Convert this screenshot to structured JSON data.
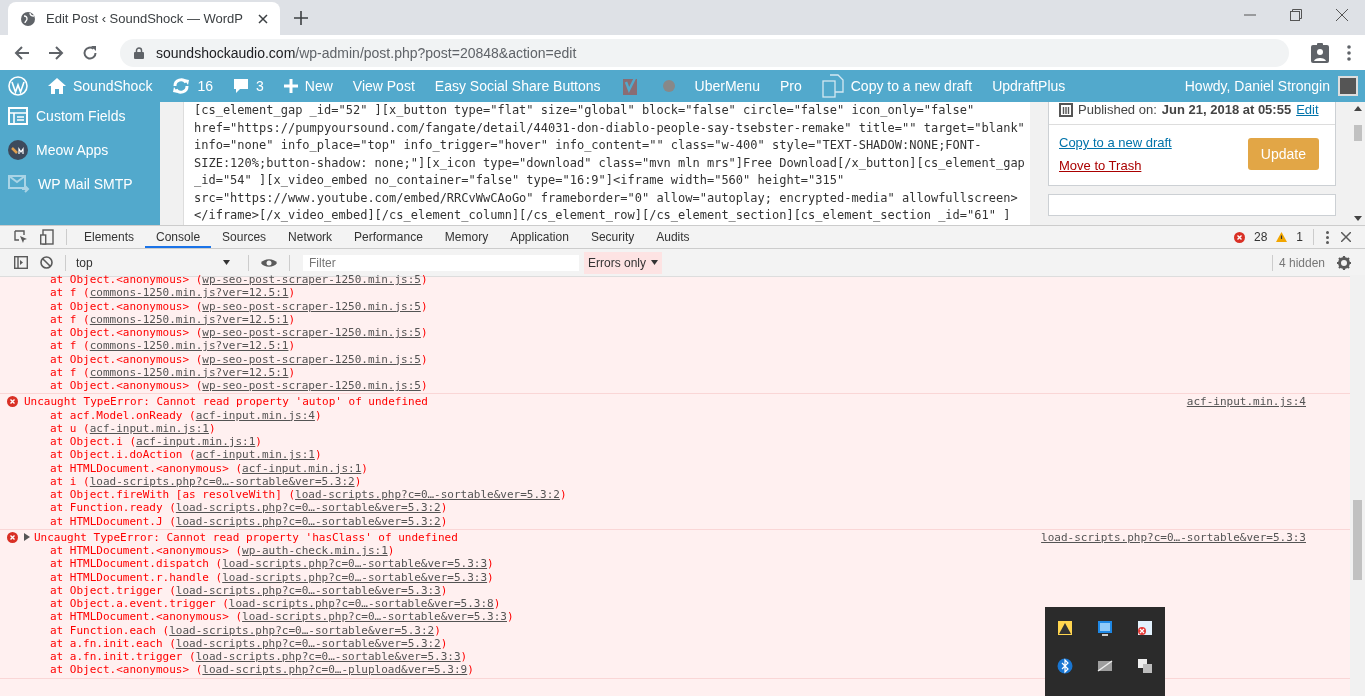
{
  "browser": {
    "tab_title": "Edit Post ‹ SoundShock — WordP",
    "url_host": "soundshockaudio.com",
    "url_path": "/wp-admin/post.php?post=20848&action=edit"
  },
  "admin_bar": {
    "items": [
      {
        "kind": "logo"
      },
      {
        "kind": "site",
        "label": "SoundShock"
      },
      {
        "kind": "updates",
        "label": "16"
      },
      {
        "kind": "comments",
        "label": "3"
      },
      {
        "kind": "new",
        "label": "New"
      },
      {
        "kind": "link",
        "label": "View Post"
      },
      {
        "kind": "link",
        "label": "Easy Social Share Buttons"
      },
      {
        "kind": "yoast"
      },
      {
        "kind": "dot"
      },
      {
        "kind": "link",
        "label": "UberMenu"
      },
      {
        "kind": "link",
        "label": "Pro"
      },
      {
        "kind": "copy",
        "label": "Copy to a new draft"
      },
      {
        "kind": "link",
        "label": "UpdraftPlus"
      }
    ],
    "account": "Howdy, Daniel Strongin"
  },
  "sidebar": {
    "items": [
      {
        "kind": "fields",
        "label": "Custom Fields"
      },
      {
        "kind": "meow",
        "label": "Meow Apps"
      },
      {
        "kind": "mail",
        "label": "WP Mail SMTP"
      }
    ]
  },
  "editor_lines": [
    "[cs_element_gap _id=\"52\" ][x_button type=\"flat\" size=\"global\" block=\"false\" circle=\"false\" icon_only=\"false\"",
    "href=\"https://pumpyoursound.com/fangate/detail/44031-don-diablo-people-say-tsebster-remake\" title=\"\" target=\"blank\"",
    "info=\"none\" info_place=\"top\" info_trigger=\"hover\" info_content=\"\" class=\"w-400\" style=\"TEXT-SHADOW:NONE;FONT-",
    "SIZE:120%;button-shadow: none;\"][x_icon type=\"download\" class=\"mvn mln mrs\"]Free Download[/x_button][cs_element_gap",
    "_id=\"54\" ][x_video_embed no_container=\"false\" type=\"16:9\"]<iframe width=\"560\" height=\"315\"",
    "src=\"https://www.youtube.com/embed/RRCvWwCAoGo\" frameborder=\"0\" allow=\"autoplay; encrypted-media\" allowfullscreen>",
    "</iframe>[/x_video_embed][/cs_element_column][/cs_element_row][/cs_element_section][cs_element_section _id=\"61\" ]"
  ],
  "publish_box": {
    "published_label": "Published on:",
    "published_date": "Jun 21, 2018 at 05:55",
    "edit_link": "Edit",
    "copy_link": "Copy to a new draft",
    "trash_link": "Move to Trash",
    "update_button": "Update"
  },
  "devtools": {
    "tabs": [
      {
        "label": "Elements",
        "selected": false
      },
      {
        "label": "Console",
        "selected": true
      },
      {
        "label": "Sources",
        "selected": false
      },
      {
        "label": "Network",
        "selected": false
      },
      {
        "label": "Performance",
        "selected": false
      },
      {
        "label": "Memory",
        "selected": false
      },
      {
        "label": "Application",
        "selected": false
      },
      {
        "label": "Security",
        "selected": false
      },
      {
        "label": "Audits",
        "selected": false
      }
    ],
    "error_count": "28",
    "warning_count": "1",
    "context": "top",
    "filter_placeholder": "Filter",
    "levels": "Errors only",
    "hidden": "4 hidden",
    "messages": [
      {
        "kind": "continuation",
        "frames": [
          {
            "call": "at Object.<anonymous> (",
            "link": "wp-seo-post-scraper-1250.min.js:5",
            "end": ")"
          },
          {
            "call": "at f (",
            "link": "commons-1250.min.js?ver=12.5:1",
            "end": ")"
          },
          {
            "call": "at Object.<anonymous> (",
            "link": "wp-seo-post-scraper-1250.min.js:5",
            "end": ")"
          },
          {
            "call": "at f (",
            "link": "commons-1250.min.js?ver=12.5:1",
            "end": ")"
          },
          {
            "call": "at Object.<anonymous> (",
            "link": "wp-seo-post-scraper-1250.min.js:5",
            "end": ")"
          },
          {
            "call": "at f (",
            "link": "commons-1250.min.js?ver=12.5:1",
            "end": ")"
          },
          {
            "call": "at Object.<anonymous> (",
            "link": "wp-seo-post-scraper-1250.min.js:5",
            "end": ")"
          },
          {
            "call": "at f (",
            "link": "commons-1250.min.js?ver=12.5:1",
            "end": ")"
          },
          {
            "call": "at Object.<anonymous> (",
            "link": "wp-seo-post-scraper-1250.min.js:5",
            "end": ")"
          }
        ]
      },
      {
        "kind": "error",
        "expandable": false,
        "text": "Uncaught TypeError: Cannot read property 'autop' of undefined",
        "source": "acf-input.min.js:4",
        "frames": [
          {
            "call": "at acf.Model.onReady (",
            "link": "acf-input.min.js:4",
            "end": ")"
          },
          {
            "call": "at u (",
            "link": "acf-input.min.js:1",
            "end": ")"
          },
          {
            "call": "at Object.i (",
            "link": "acf-input.min.js:1",
            "end": ")"
          },
          {
            "call": "at Object.i.doAction (",
            "link": "acf-input.min.js:1",
            "end": ")"
          },
          {
            "call": "at HTMLDocument.<anonymous> (",
            "link": "acf-input.min.js:1",
            "end": ")"
          },
          {
            "call": "at i (",
            "link": "load-scripts.php?c=0…-sortable&ver=5.3:2",
            "end": ")"
          },
          {
            "call": "at Object.fireWith [as resolveWith] (",
            "link": "load-scripts.php?c=0…-sortable&ver=5.3:2",
            "end": ")"
          },
          {
            "call": "at Function.ready (",
            "link": "load-scripts.php?c=0…-sortable&ver=5.3:2",
            "end": ")"
          },
          {
            "call": "at HTMLDocument.J (",
            "link": "load-scripts.php?c=0…-sortable&ver=5.3:2",
            "end": ")"
          }
        ]
      },
      {
        "kind": "error",
        "expandable": true,
        "text": "Uncaught TypeError: Cannot read property 'hasClass' of undefined",
        "source": "load-scripts.php?c=0…-sortable&ver=5.3:3",
        "frames": [
          {
            "call": "at HTMLDocument.<anonymous> (",
            "link": "wp-auth-check.min.js:1",
            "end": ")"
          },
          {
            "call": "at HTMLDocument.dispatch (",
            "link": "load-scripts.php?c=0…-sortable&ver=5.3:3",
            "end": ")"
          },
          {
            "call": "at HTMLDocument.r.handle (",
            "link": "load-scripts.php?c=0…-sortable&ver=5.3:3",
            "end": ")"
          },
          {
            "call": "at Object.trigger (",
            "link": "load-scripts.php?c=0…-sortable&ver=5.3:3",
            "end": ")"
          },
          {
            "call": "at Object.a.event.trigger (",
            "link": "load-scripts.php?c=0…-sortable&ver=5.3:8",
            "end": ")"
          },
          {
            "call": "at HTMLDocument.<anonymous> (",
            "link": "load-scripts.php?c=0…-sortable&ver=5.3:3",
            "end": ")"
          },
          {
            "call": "at Function.each (",
            "link": "load-scripts.php?c=0…-sortable&ver=5.3:2",
            "end": ")"
          },
          {
            "call": "at a.fn.init.each (",
            "link": "load-scripts.php?c=0…-sortable&ver=5.3:2",
            "end": ")"
          },
          {
            "call": "at a.fn.init.trigger (",
            "link": "load-scripts.php?c=0…-sortable&ver=5.3:3",
            "end": ")"
          },
          {
            "call": "at Object.<anonymous> (",
            "link": "load-scripts.php?c=0…-plupload&ver=5.3:9",
            "end": ")"
          }
        ]
      }
    ]
  },
  "tray": {
    "icons": [
      {
        "kind": "warning"
      },
      {
        "kind": "monitor"
      },
      {
        "kind": "error"
      },
      {
        "kind": "bluetooth"
      },
      {
        "kind": "display"
      },
      {
        "kind": "window"
      }
    ]
  }
}
